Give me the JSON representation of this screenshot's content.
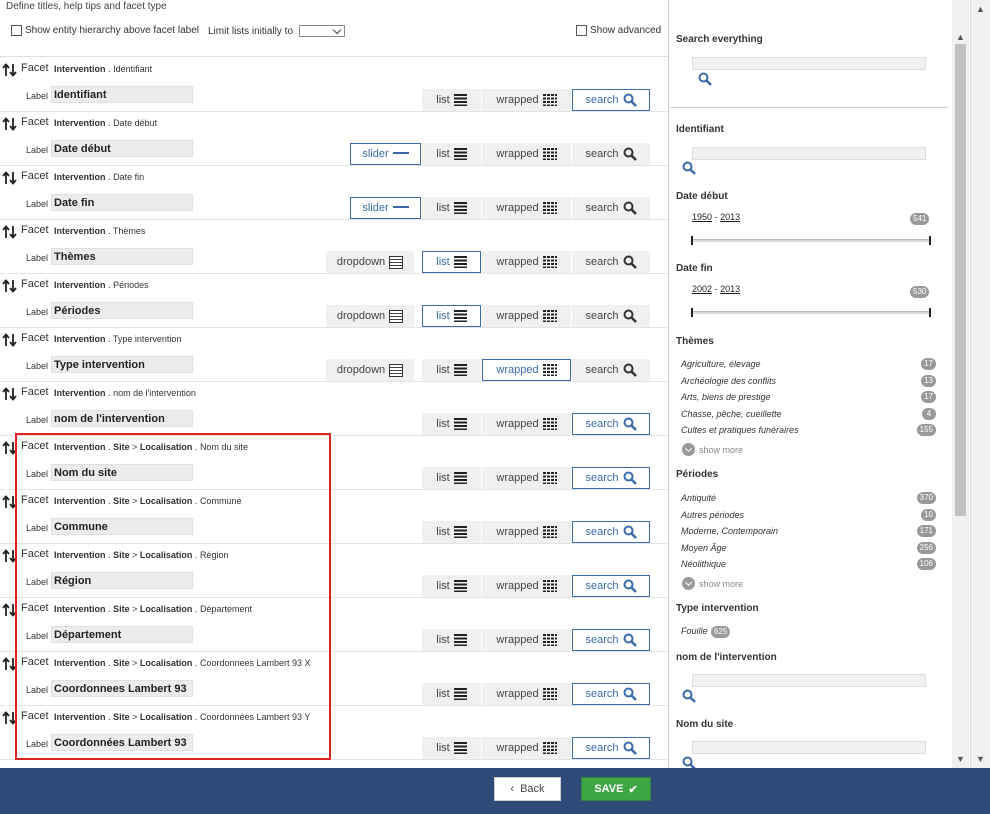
{
  "header": {
    "title": "Define titles, help tips and facet type",
    "show_hierarchy_label": "Show entity hierarchy above facet label",
    "limit_lists_label": "Limit lists initially to",
    "show_advanced_label": "Show advanced"
  },
  "facet_word": "Facet",
  "label_word": "Label",
  "sep": ".",
  "hier_sep": ">",
  "type_labels": {
    "list": "list",
    "wrapped": "wrapped",
    "search": "search",
    "dropdown": "dropdown",
    "slider": "slider"
  },
  "facets": [
    {
      "entity": "Intervention",
      "field": "Identifiant",
      "label": "Identifiant",
      "active": "search"
    },
    {
      "entity": "Intervention",
      "field": "Date début",
      "label": "Date début",
      "active": "slider"
    },
    {
      "entity": "Intervention",
      "field": "Date fin",
      "label": "Date fin",
      "active": "slider"
    },
    {
      "entity": "Intervention",
      "field": "Thèmes",
      "label": "Thèmes",
      "active": "list"
    },
    {
      "entity": "Intervention",
      "field": "Périodes",
      "label": "Périodes",
      "active": "list"
    },
    {
      "entity": "Intervention",
      "field": "Type intervention",
      "label": "Type intervention",
      "active": "wrapped"
    },
    {
      "entity": "Intervention",
      "field": "nom de l'intervention",
      "label": "nom de l'intervention",
      "active": "search"
    },
    {
      "entity": "Intervention",
      "sub1": "Site",
      "sub2": "Localisation",
      "field": "Nom du site",
      "label": "Nom du site",
      "active": "search"
    },
    {
      "entity": "Intervention",
      "sub1": "Site",
      "sub2": "Localisation",
      "field": "Commune",
      "label": "Commune",
      "active": "search"
    },
    {
      "entity": "Intervention",
      "sub1": "Site",
      "sub2": "Localisation",
      "field": "Région",
      "label": "Région",
      "active": "search"
    },
    {
      "entity": "Intervention",
      "sub1": "Site",
      "sub2": "Localisation",
      "field": "Département",
      "label": "Département",
      "active": "search"
    },
    {
      "entity": "Intervention",
      "sub1": "Site",
      "sub2": "Localisation",
      "field": "Coordonnees Lambert 93 X",
      "label": "Coordonnees Lambert 93",
      "active": "search"
    },
    {
      "entity": "Intervention",
      "sub1": "Site",
      "sub2": "Localisation",
      "field": "Coordonnées Lambert 93 Y",
      "label": "Coordonnées Lambert 93",
      "active": "search"
    }
  ],
  "preview": {
    "search_everything": "Search everything",
    "identifiant_title": "Identifiant",
    "date_debut": {
      "title": "Date début",
      "from": "1950",
      "to": "2013",
      "dash": "-",
      "count": "541"
    },
    "date_fin": {
      "title": "Date fin",
      "from": "2002",
      "to": "2013",
      "dash": "-",
      "count": "530"
    },
    "themes": {
      "title": "Thèmes",
      "items": [
        {
          "label": "Agriculture, élevage",
          "count": "17"
        },
        {
          "label": "Archéologie des conflits",
          "count": "13"
        },
        {
          "label": "Arts, biens de prestige",
          "count": "17"
        },
        {
          "label": "Chasse, pêche, cueillette",
          "count": "4"
        },
        {
          "label": "Cultes et pratiques funéraires",
          "count": "155"
        }
      ]
    },
    "periodes": {
      "title": "Périodes",
      "items": [
        {
          "label": "Antiquité",
          "count": "370"
        },
        {
          "label": "Autres périodes",
          "count": "10"
        },
        {
          "label": "Moderne, Contemporain",
          "count": "171"
        },
        {
          "label": "Moyen Âge",
          "count": "256"
        },
        {
          "label": "Néolithique",
          "count": "106"
        }
      ]
    },
    "show_more": "show more",
    "type_intervention": {
      "title": "Type intervention",
      "item": "Fouille",
      "count": "625"
    },
    "nom_intervention_title": "nom de l'intervention",
    "nom_site_title": "Nom du site"
  },
  "footer": {
    "back_label": "Back",
    "save_label": "SAVE"
  },
  "colors": {
    "accent": "#3b6aa8",
    "footer": "#2e4a78",
    "save": "#3ea644",
    "highlight": "#dd2222"
  }
}
